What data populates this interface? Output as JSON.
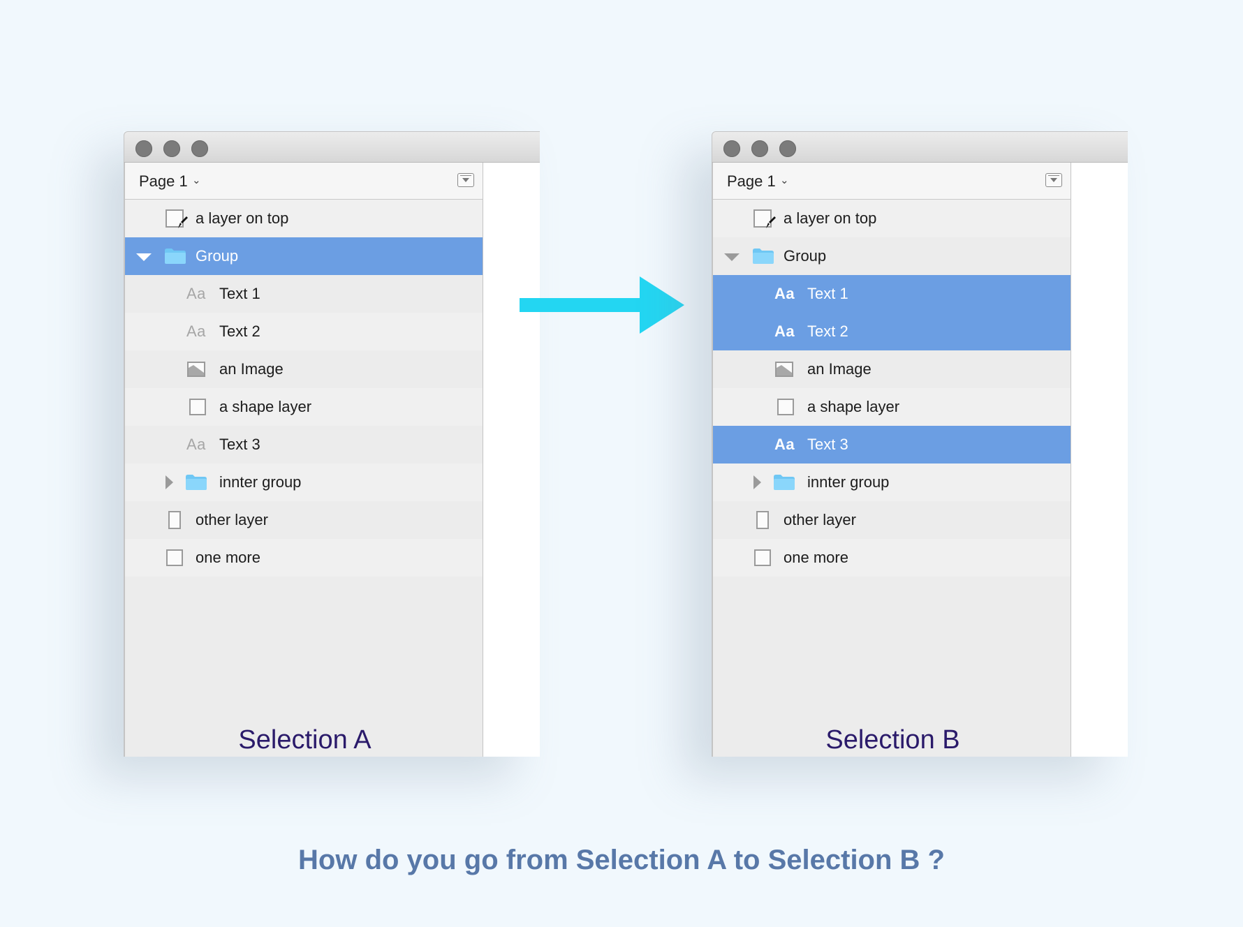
{
  "question": "How do you go from Selection A to Selection B ?",
  "colors": {
    "selection": "#6b9ee3",
    "arrow": "#23d6f2",
    "caption": "#2a1a6a",
    "question": "#5878a8"
  },
  "panel_a": {
    "page_label": "Page 1",
    "caption": "Selection A",
    "layers": [
      {
        "label": "a layer on top",
        "icon": "artboard-icon"
      },
      {
        "label": "Group",
        "icon": "folder-icon"
      },
      {
        "icon_text": "Aa",
        "label": "Text 1",
        "icon": "text-icon"
      },
      {
        "icon_text": "Aa",
        "label": "Text 2",
        "icon": "text-icon"
      },
      {
        "label": "an Image",
        "icon": "image-icon"
      },
      {
        "label": "a shape layer",
        "icon": "shape-icon"
      },
      {
        "icon_text": "Aa",
        "label": "Text 3",
        "icon": "text-icon"
      },
      {
        "label": "innter group",
        "icon": "folder-icon"
      },
      {
        "label": "other layer",
        "icon": "rectangle-icon"
      },
      {
        "label": "one more",
        "icon": "shape-icon"
      }
    ]
  },
  "panel_b": {
    "page_label": "Page 1",
    "caption": "Selection B",
    "layers": [
      {
        "label": "a layer on top",
        "icon": "artboard-icon"
      },
      {
        "label": "Group",
        "icon": "folder-icon"
      },
      {
        "icon_text": "Aa",
        "label": "Text 1",
        "icon": "text-icon"
      },
      {
        "icon_text": "Aa",
        "label": "Text 2",
        "icon": "text-icon"
      },
      {
        "label": "an Image",
        "icon": "image-icon"
      },
      {
        "label": "a shape layer",
        "icon": "shape-icon"
      },
      {
        "icon_text": "Aa",
        "label": "Text 3",
        "icon": "text-icon"
      },
      {
        "label": "innter group",
        "icon": "folder-icon"
      },
      {
        "label": "other layer",
        "icon": "rectangle-icon"
      },
      {
        "label": "one more",
        "icon": "shape-icon"
      }
    ]
  }
}
